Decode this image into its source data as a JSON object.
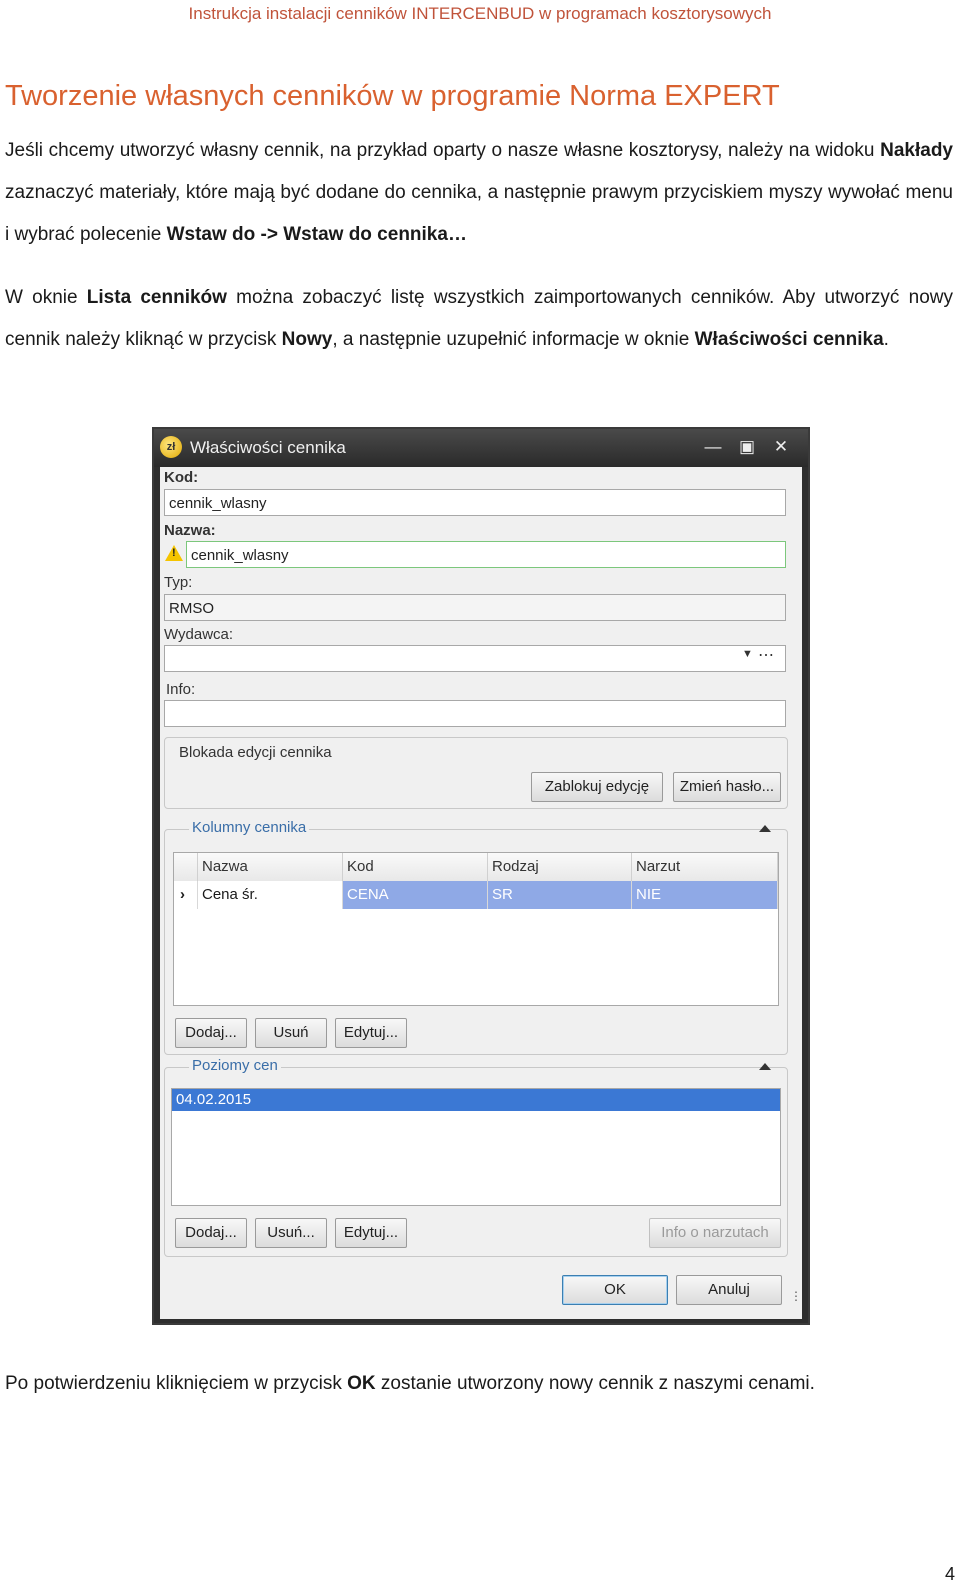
{
  "header": "Instrukcja instalacji cenników INTERCENBUD w programach kosztorysowych",
  "title": "Tworzenie własnych cenników w programie Norma EXPERT",
  "paragraph1": {
    "t1": "Jeśli chcemy utworzyć własny cennik, na przykład oparty o nasze własne kosztorysy, należy na widoku ",
    "b1": "Nakłady",
    "t2": " zaznaczyć materiały, które mają być dodane do cennika, a następnie prawym przyciskiem myszy wywołać menu i wybrać polecenie ",
    "b2": "Wstaw do -> Wstaw do cennika…"
  },
  "paragraph2": {
    "t1": "W oknie ",
    "b1": "Lista cenników",
    "t2": " można zobaczyć listę wszystkich zaimportowanych cenników. Aby utworzyć nowy cennik należy kliknąć w przycisk ",
    "b2": "Nowy",
    "t3": ", a następnie uzupełnić informacje w oknie ",
    "b3": "Właściwości cennika",
    "t4": "."
  },
  "paragraph3": {
    "t1": "Po potwierdzeniu kliknięciem w przycisk ",
    "b1": "OK",
    "t2": " zostanie utworzony nowy cennik z naszymi cenami."
  },
  "page_number": "4",
  "dialog": {
    "title": "Właściwości cennika",
    "kod_label": "Kod:",
    "kod_value": "cennik_wlasny",
    "nazwa_label": "Nazwa:",
    "nazwa_value": "cennik_wlasny",
    "typ_label": "Typ:",
    "typ_value": "RMSO",
    "wydawca_label": "Wydawca:",
    "wydawca_value": "",
    "info_label": "Info:",
    "info_value": "",
    "lock_group": "Blokada edycji cennika",
    "lock_button": "Zablokuj edycję",
    "password_button": "Zmień hasło...",
    "columns_group": "Kolumny cennika",
    "columns_headers": [
      "Nazwa",
      "Kod",
      "Rodzaj",
      "Narzut"
    ],
    "columns_row": [
      "Cena śr.",
      "CENA",
      "SR",
      "NIE"
    ],
    "col_add": "Dodaj...",
    "col_remove": "Usuń",
    "col_edit": "Edytuj...",
    "levels_group": "Poziomy cen",
    "levels_items": [
      "04.02.2015"
    ],
    "lvl_add": "Dodaj...",
    "lvl_remove": "Usuń...",
    "lvl_edit": "Edytuj...",
    "lvl_info": "Info o narzutach",
    "ok": "OK",
    "cancel": "Anuluj"
  }
}
